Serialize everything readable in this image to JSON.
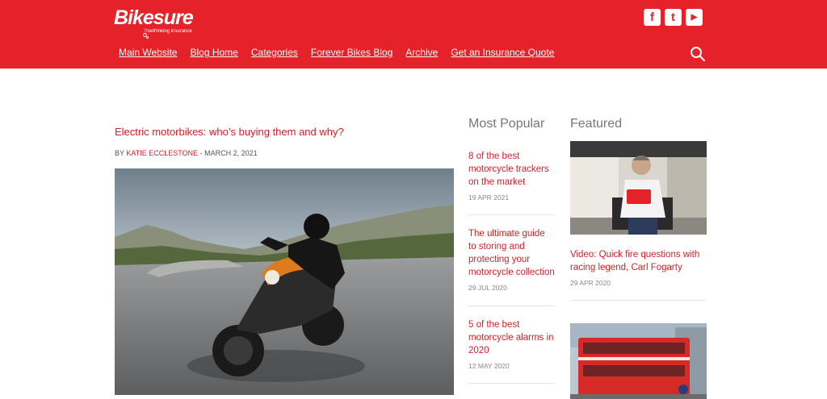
{
  "brand": {
    "logo_text": "Bikesure",
    "logo_tagline": "freethinking insurance",
    "red": "#e52229"
  },
  "nav": {
    "items": [
      {
        "label": "Main Website"
      },
      {
        "label": "Blog Home"
      },
      {
        "label": "Categories"
      },
      {
        "label": "Forever Bikes Blog"
      },
      {
        "label": "Archive"
      },
      {
        "label": "Get an Insurance Quote"
      }
    ]
  },
  "social": {
    "icons": [
      "facebook-icon",
      "twitter-icon",
      "youtube-icon"
    ],
    "facebook": "f",
    "twitter": "t",
    "youtube": "▶"
  },
  "article": {
    "title": "Electric motorbikes: who’s buying them and why?",
    "by": "BY",
    "author": "KATIE ECCLESTONE",
    "date": "- MARCH 2, 2021"
  },
  "most_popular": {
    "heading": "Most Popular",
    "items": [
      {
        "title": "8 of the best motorcycle trackers on the market",
        "date": "19 APR 2021"
      },
      {
        "title": "The ultimate guide to storing and protecting your motorcycle collection",
        "date": "29 JUL 2020"
      },
      {
        "title": "5 of the best motorcycle alarms in 2020",
        "date": "12 MAY 2020"
      }
    ]
  },
  "featured": {
    "heading": "Featured",
    "items": [
      {
        "title": "Video: Quick fire questions with racing legend, Carl Fogarty",
        "date": "29 APR 2020"
      }
    ]
  }
}
